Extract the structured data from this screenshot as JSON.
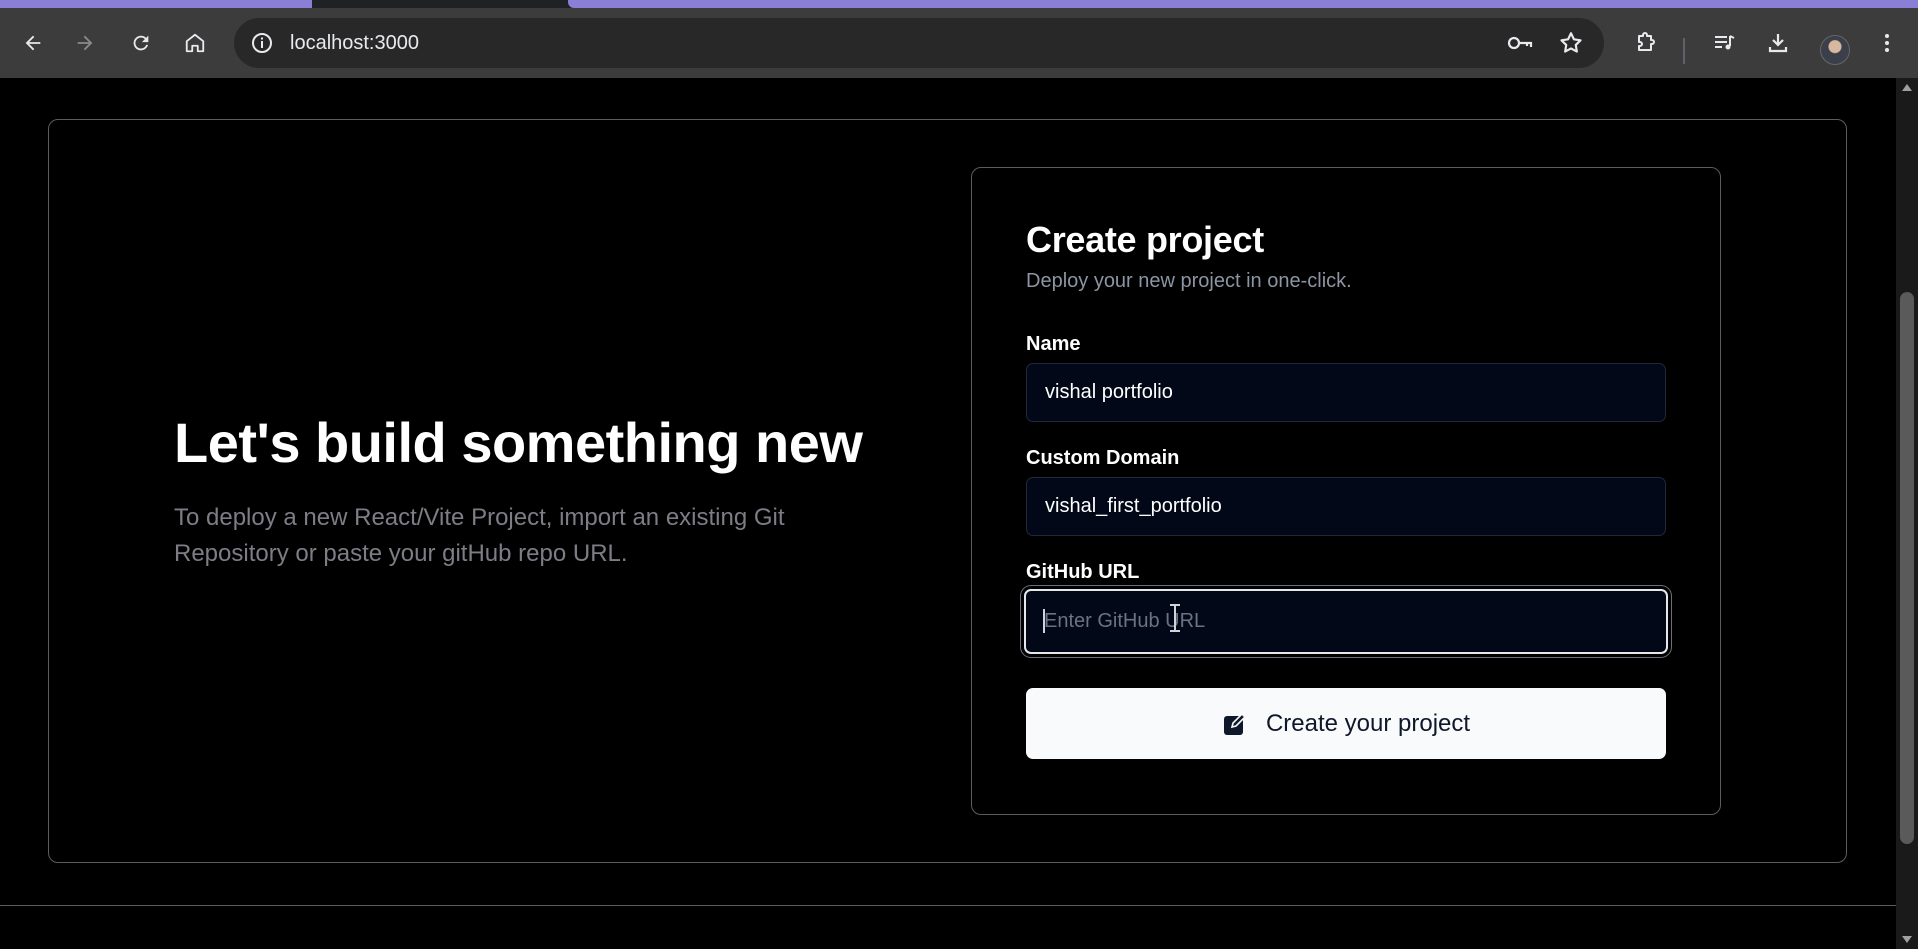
{
  "browser": {
    "url": "localhost:3000",
    "icons": [
      "back-arrow-icon",
      "forward-arrow-icon",
      "reload-icon",
      "home-icon",
      "site-info-icon",
      "password-key-icon",
      "bookmark-star-icon",
      "extensions-icon",
      "media-controls-icon",
      "download-icon",
      "profile-avatar",
      "more-menu-icon"
    ]
  },
  "hero": {
    "title": "Let's build something new",
    "description": "To deploy a new React/Vite Project, import an existing Git Repository or paste your gitHub repo URL."
  },
  "form": {
    "title": "Create project",
    "subtitle": "Deploy your new project in one-click.",
    "fields": {
      "name": {
        "label": "Name",
        "value": "vishal portfolio"
      },
      "domain": {
        "label": "Custom Domain",
        "value": "vishal_first_portfolio"
      },
      "github": {
        "label": "GitHub URL",
        "value": "",
        "placeholder": "Enter GitHub URL"
      }
    },
    "submit_label": "Create your project",
    "submit_icon": "edit-square-icon"
  },
  "colors": {
    "page_bg": "#000000",
    "input_bg": "#020817",
    "button_bg": "#f8fafc",
    "muted_text": "#7d7d86",
    "border": "#5c5c5c"
  }
}
